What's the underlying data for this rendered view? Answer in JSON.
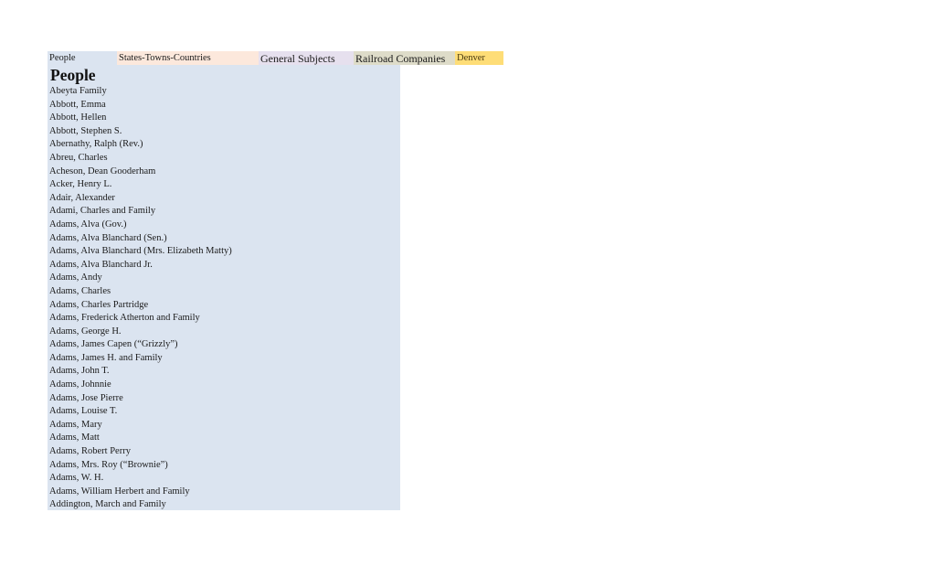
{
  "tabs": [
    {
      "label": "People"
    },
    {
      "label": "States-Towns-Countries"
    },
    {
      "label": "General Subjects"
    },
    {
      "label": "Railroad Companies"
    },
    {
      "label": "Denver"
    }
  ],
  "section": {
    "title": "People",
    "items": [
      "Abeyta Family",
      "Abbott, Emma",
      "Abbott, Hellen",
      "Abbott, Stephen S.",
      "Abernathy, Ralph (Rev.)",
      "Abreu, Charles",
      "Acheson, Dean Gooderham",
      "Acker, Henry L.",
      "Adair, Alexander",
      "Adami, Charles and Family",
      "Adams, Alva (Gov.)",
      "Adams, Alva Blanchard (Sen.)",
      "Adams, Alva Blanchard (Mrs. Elizabeth Matty)",
      "Adams, Alva Blanchard Jr.",
      "Adams, Andy",
      "Adams, Charles",
      "Adams, Charles Partridge",
      "Adams, Frederick Atherton and Family",
      "Adams, George H.",
      "Adams, James Capen (“Grizzly”)",
      "Adams, James H. and Family",
      "Adams, John T.",
      "Adams, Johnnie",
      "Adams, Jose Pierre",
      "Adams, Louise T.",
      "Adams, Mary",
      "Adams, Matt",
      "Adams, Robert Perry",
      "Adams, Mrs. Roy (“Brownie”)",
      "Adams, W. H.",
      "Adams, William Herbert and Family",
      "Addington, March and Family"
    ]
  }
}
